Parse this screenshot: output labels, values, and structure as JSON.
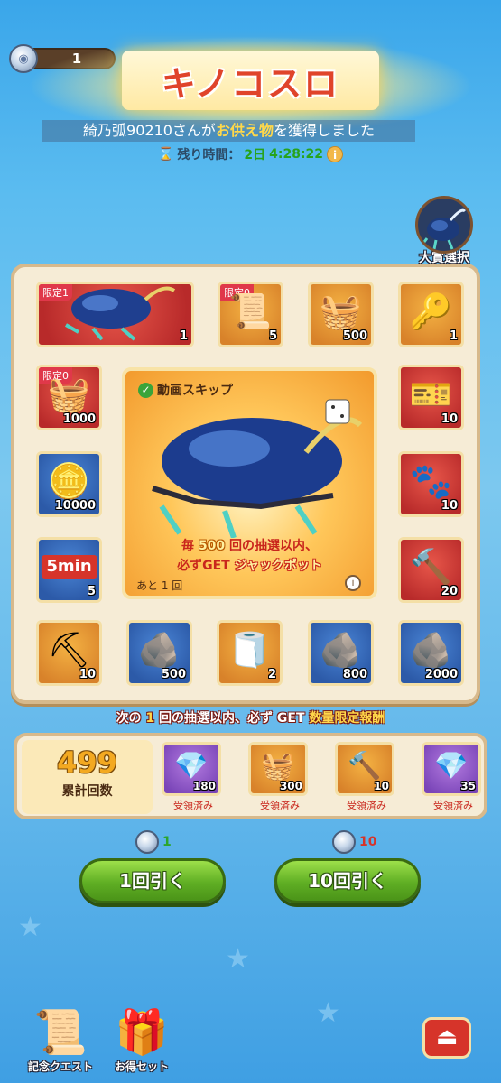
{
  "header": {
    "coin_count": "1",
    "title": "キノコスロ",
    "ticker_user": "綺乃弧90210さんが",
    "ticker_item": "お供え物",
    "ticker_tail": "を獲得しました",
    "timer_label": "残り時間：",
    "timer_days": "2日",
    "timer_time": "4:28:22",
    "info": "i"
  },
  "grand_prize": {
    "label": "大賞選択"
  },
  "board": {
    "cells": [
      {
        "limit": "限定1",
        "qty": "1"
      },
      {
        "limit": "限定0",
        "qty": "5"
      },
      {
        "limit": "",
        "qty": "500"
      },
      {
        "limit": "",
        "qty": "1"
      },
      {
        "limit": "限定0",
        "qty": "1000"
      },
      {
        "limit": "",
        "qty": "10"
      },
      {
        "limit": "",
        "qty": "10000"
      },
      {
        "limit": "",
        "qty": "10"
      },
      {
        "limit": "",
        "qty": "5"
      },
      {
        "limit": "",
        "qty": "20"
      },
      {
        "limit": "",
        "qty": "10"
      },
      {
        "limit": "",
        "qty": "500"
      },
      {
        "limit": "",
        "qty": "2"
      },
      {
        "limit": "",
        "qty": "800"
      },
      {
        "limit": "",
        "qty": "2000"
      }
    ],
    "ticket_text": "5min",
    "featured": {
      "skip_label": "動画スキップ",
      "line1_pre": "毎 ",
      "line1_num": "500",
      "line1_post": " 回の抽選以内、",
      "line2_pre": "必ずGET ",
      "line2_jp": "ジャックポット",
      "remaining": "あと 1 回",
      "info": "i"
    }
  },
  "notice": {
    "pre": "次の ",
    "num": "1",
    "mid": " 回の抽選以内、必ず GET ",
    "hl": "数量限定報酬"
  },
  "milestones": {
    "total_value": "499",
    "total_label": "累計回数",
    "items": [
      {
        "qty": "180",
        "status": "受領済み"
      },
      {
        "qty": "300",
        "status": "受領済み"
      },
      {
        "qty": "10",
        "status": "受領済み"
      },
      {
        "qty": "35",
        "status": "受領済み"
      }
    ]
  },
  "draw": {
    "cost1": "1",
    "cost10": "10",
    "btn1": "1回引く",
    "btn10": "10回引く"
  },
  "bottom": {
    "quest": "記念クエスト",
    "set": "お得セット"
  },
  "colors": {
    "accent_green": "#5fae24",
    "title_red": "#e0442b",
    "board_bg": "#f6ecd6"
  }
}
